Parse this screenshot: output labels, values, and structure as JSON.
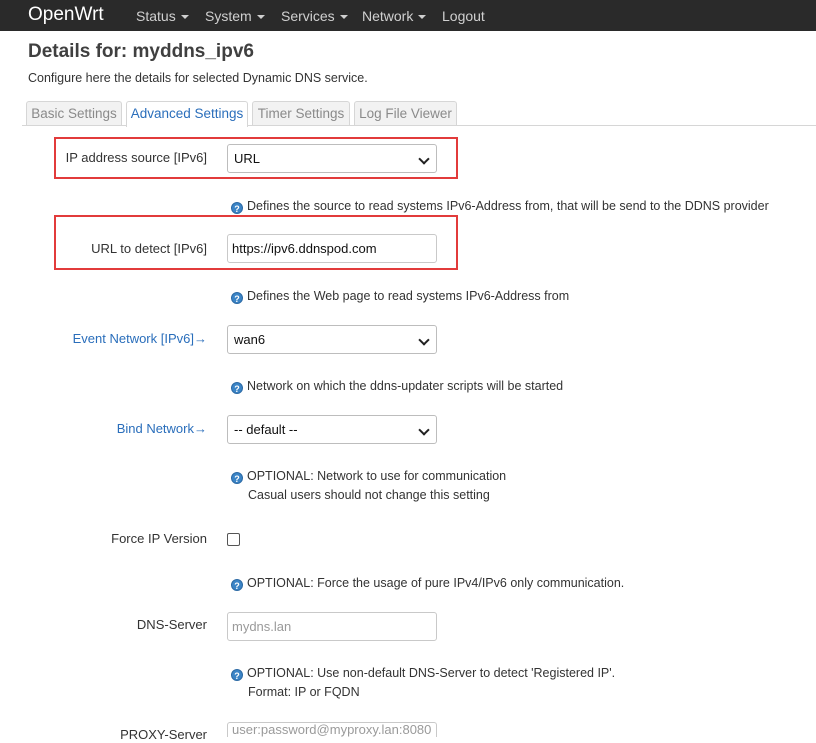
{
  "navbar": {
    "brand": "OpenWrt",
    "items": [
      {
        "label": "Status",
        "has_caret": true
      },
      {
        "label": "System",
        "has_caret": true
      },
      {
        "label": "Services",
        "has_caret": true
      },
      {
        "label": "Network",
        "has_caret": true
      },
      {
        "label": "Logout",
        "has_caret": false
      }
    ]
  },
  "header": {
    "title": "Details for: myddns_ipv6",
    "description": "Configure here the details for selected Dynamic DNS service."
  },
  "tabs": [
    {
      "label": "Basic Settings",
      "active": false
    },
    {
      "label": "Advanced Settings",
      "active": true
    },
    {
      "label": "Timer Settings",
      "active": false
    },
    {
      "label": "Log File Viewer",
      "active": false
    }
  ],
  "form": {
    "ip_source": {
      "label": "IP address source [IPv6]",
      "value": "URL",
      "help": "Defines the source to read systems IPv6-Address from, that will be send to the DDNS provider"
    },
    "url_detect": {
      "label": "URL to detect [IPv6]",
      "value": "https://ipv6.ddnspod.com",
      "help": "Defines the Web page to read systems IPv6-Address from"
    },
    "event_network": {
      "label": "Event Network [IPv6]→",
      "value": "wan6",
      "help": "Network on which the ddns-updater scripts will be started"
    },
    "bind_network": {
      "label": "Bind Network→",
      "value": "-- default --",
      "help_line1": "OPTIONAL: Network to use for communication",
      "help_line2": "Casual users should not change this setting"
    },
    "force_ip": {
      "label": "Force IP Version",
      "checked": false,
      "help": "OPTIONAL: Force the usage of pure IPv4/IPv6 only communication."
    },
    "dns_server": {
      "label": "DNS-Server",
      "placeholder": "mydns.lan",
      "help_line1": "OPTIONAL: Use non-default DNS-Server to detect 'Registered IP'.",
      "help_line2": "Format: IP or FQDN"
    },
    "proxy_server": {
      "label": "PROXY-Server",
      "placeholder": "user:password@myproxy.lan:8080"
    }
  },
  "icons": {
    "help": "help-circle-icon",
    "caret": "caret-down-icon",
    "select_chevron": "chevron-down-icon"
  },
  "colors": {
    "navbar_bg": "#2a2a2a",
    "link": "#2a6ebb",
    "highlight": "#e23b3b",
    "help_icon": "#3b84c6"
  }
}
